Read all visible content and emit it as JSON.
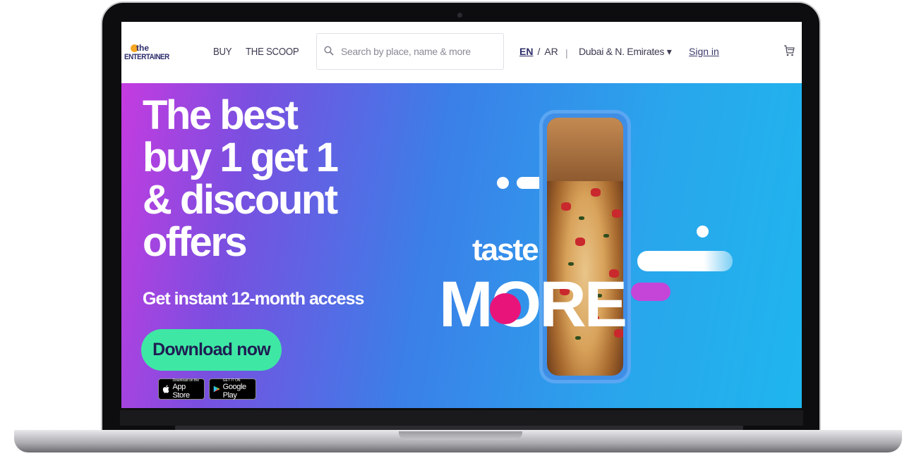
{
  "nav": {
    "logo_the": "the",
    "logo_main": "ENTERTAINER",
    "buy": "BUY",
    "scoop": "THE SCOOP",
    "search_placeholder": "Search by place, name & more",
    "lang_en": "EN",
    "lang_sep": "/",
    "lang_ar": "AR",
    "pipe": "|",
    "region": "Dubai & N. Emirates ▾",
    "signin": "Sign in"
  },
  "hero": {
    "headline_lines": [
      "The best",
      "buy 1 get 1",
      "& discount",
      "offers"
    ],
    "subhead": "Get instant 12-month access",
    "cta": "Download now",
    "apple_small": "Download on the",
    "apple_big": "App Store",
    "google_small": "GET IT ON",
    "google_big": "Google Play",
    "taste": "taste",
    "more": "MORE"
  },
  "colors": {
    "cta": "#3ee8a4",
    "accent_pink": "#e8147a",
    "brand_navy": "#2d2d6b"
  }
}
